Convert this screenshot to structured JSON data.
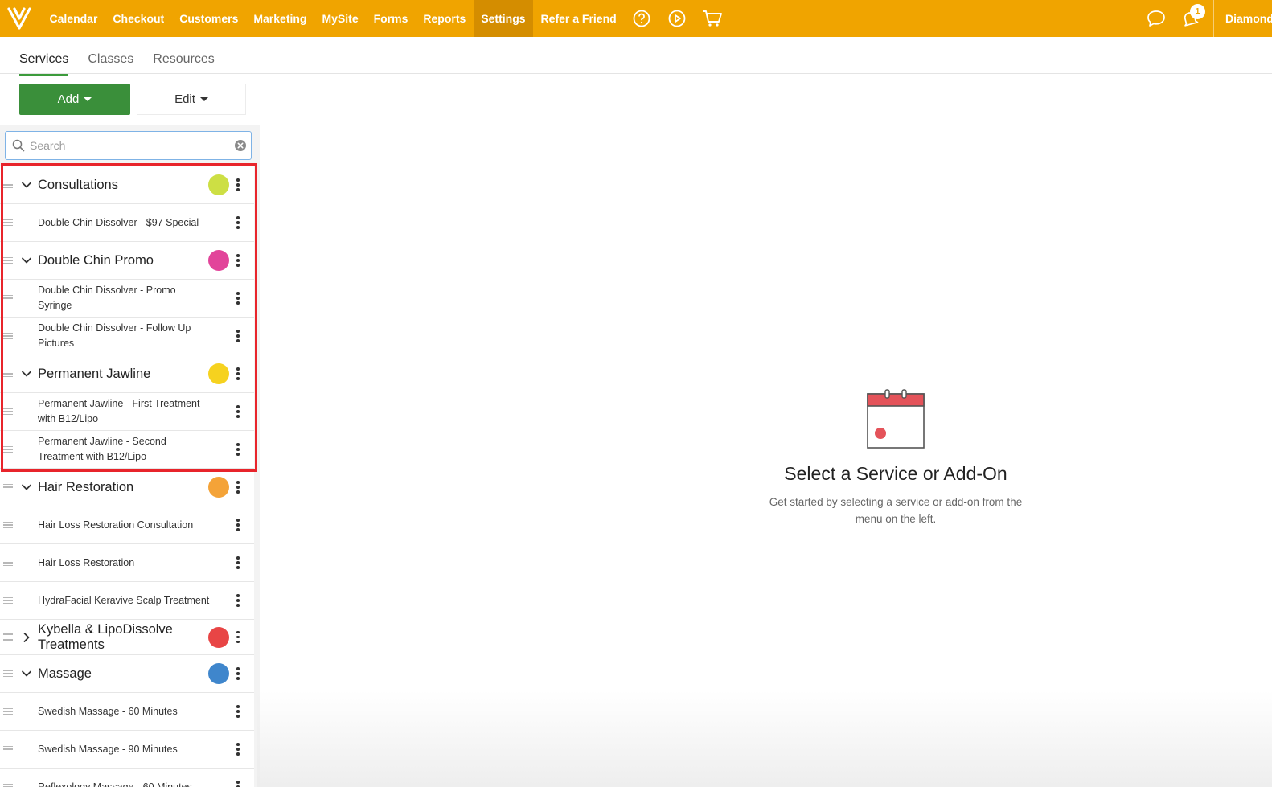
{
  "nav": {
    "items": [
      {
        "label": "Calendar",
        "active": false
      },
      {
        "label": "Checkout",
        "active": false
      },
      {
        "label": "Customers",
        "active": false
      },
      {
        "label": "Marketing",
        "active": false
      },
      {
        "label": "MySite",
        "active": false
      },
      {
        "label": "Forms",
        "active": false
      },
      {
        "label": "Reports",
        "active": false
      },
      {
        "label": "Settings",
        "active": true
      },
      {
        "label": "Refer a Friend",
        "active": false
      }
    ],
    "icons": [
      "help-icon",
      "play-icon",
      "cart-icon"
    ],
    "notification_count": "1",
    "account_label": "Diamond",
    "bar_color": "#f0a400"
  },
  "subtabs": {
    "services": "Services",
    "classes": "Classes",
    "resources": "Resources"
  },
  "actions": {
    "add_label": "Add",
    "edit_label": "Edit"
  },
  "search": {
    "placeholder": "Search",
    "value": ""
  },
  "list": [
    {
      "type": "category",
      "name": "Consultations",
      "color": "#cddf44",
      "expanded": true
    },
    {
      "type": "service",
      "name": "Double Chin Dissolver - $97 Special"
    },
    {
      "type": "category",
      "name": "Double Chin Promo",
      "color": "#e2449a",
      "expanded": true
    },
    {
      "type": "service",
      "name": "Double Chin Dissolver - Promo Syringe"
    },
    {
      "type": "service",
      "name": "Double Chin Dissolver - Follow Up Pictures"
    },
    {
      "type": "category",
      "name": "Permanent Jawline",
      "color": "#f6d21f",
      "expanded": true
    },
    {
      "type": "service",
      "name": "Permanent Jawline - First Treatment with B12/Lipo"
    },
    {
      "type": "service",
      "name": "Permanent Jawline - Second Treatment with B12/Lipo"
    },
    {
      "type": "category",
      "name": "Hair Restoration",
      "color": "#f4a338",
      "expanded": true
    },
    {
      "type": "service",
      "name": "Hair Loss Restoration Consultation"
    },
    {
      "type": "service",
      "name": "Hair Loss Restoration"
    },
    {
      "type": "service",
      "name": "HydraFacial Keravive Scalp Treatment"
    },
    {
      "type": "category",
      "name": "Kybella & LipoDissolve Treatments",
      "color": "#e84545",
      "expanded": false
    },
    {
      "type": "category",
      "name": "Massage",
      "color": "#3f86cc",
      "expanded": true
    },
    {
      "type": "service",
      "name": "Swedish Massage - 60 Minutes"
    },
    {
      "type": "service",
      "name": "Swedish Massage - 90 Minutes"
    },
    {
      "type": "service",
      "name": "Reflexology Massage - 60 Minutes"
    }
  ],
  "empty_state": {
    "title": "Select a Service or Add-On",
    "subtitle": "Get started by selecting a service or add-on from the menu on the left.",
    "icon": "calendar-icon"
  }
}
